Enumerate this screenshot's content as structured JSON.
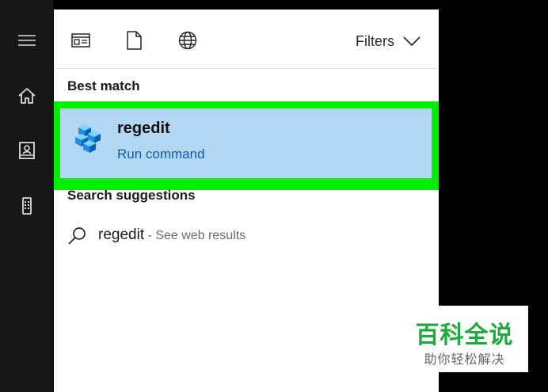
{
  "sidebar": {
    "items": [
      {
        "icon": "hamburger-menu-icon"
      },
      {
        "icon": "home-icon"
      },
      {
        "icon": "documents-icon"
      },
      {
        "icon": "device-icon"
      }
    ]
  },
  "toolbar": {
    "icons": [
      "apps-icon",
      "document-icon",
      "globe-icon"
    ],
    "filters_label": "Filters"
  },
  "best_match": {
    "label": "Best match",
    "title": "regedit",
    "subtitle": "Run command",
    "icon": "registry-editor-icon",
    "highlight_color": "#00ee00",
    "selected_bg": "#b3d7f2"
  },
  "suggestions": {
    "label": "Search suggestions",
    "items": [
      {
        "query": "regedit",
        "suffix": " - See web results",
        "icon": "search-icon"
      }
    ]
  },
  "watermark": {
    "title": "百科全说",
    "subtitle": "助你轻松解决"
  }
}
